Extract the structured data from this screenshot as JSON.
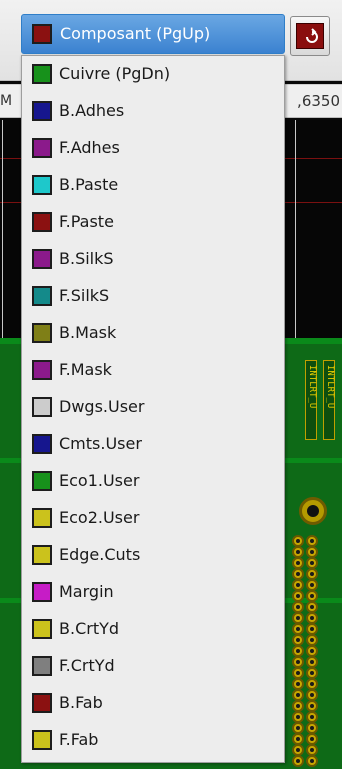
{
  "layer_selector": {
    "selected": {
      "label": "Composant (PgUp)",
      "color": "#8b1111"
    }
  },
  "toolbar": {
    "tool_icon": "red-layer-pair-icon"
  },
  "status": {
    "left_fragment": "M",
    "coordinate": ",6350"
  },
  "layers": [
    {
      "label": "Cuivre (PgDn)",
      "color": "#17911b"
    },
    {
      "label": "B.Adhes",
      "color": "#16168e"
    },
    {
      "label": "F.Adhes",
      "color": "#8b1a8b"
    },
    {
      "label": "B.Paste",
      "color": "#1ec8cb"
    },
    {
      "label": "F.Paste",
      "color": "#8b1111"
    },
    {
      "label": "B.SilkS",
      "color": "#8b1a8b"
    },
    {
      "label": "F.SilkS",
      "color": "#148a8a"
    },
    {
      "label": "B.Mask",
      "color": "#7f7f17"
    },
    {
      "label": "F.Mask",
      "color": "#8b1a8b"
    },
    {
      "label": "Dwgs.User",
      "color": "#cccccc"
    },
    {
      "label": "Cmts.User",
      "color": "#16168e"
    },
    {
      "label": "Eco1.User",
      "color": "#17911b"
    },
    {
      "label": "Eco2.User",
      "color": "#cbc21c"
    },
    {
      "label": "Edge.Cuts",
      "color": "#cbc21c"
    },
    {
      "label": "Margin",
      "color": "#c61cc6"
    },
    {
      "label": "B.CrtYd",
      "color": "#cbc21c"
    },
    {
      "label": "F.CrtYd",
      "color": "#7f7f7f"
    },
    {
      "label": "B.Fab",
      "color": "#8b1111"
    },
    {
      "label": "F.Fab",
      "color": "#cbc21c"
    }
  ],
  "canvas": {
    "connector_labels": [
      "INTLRT_U",
      "INTLRT_U"
    ]
  }
}
